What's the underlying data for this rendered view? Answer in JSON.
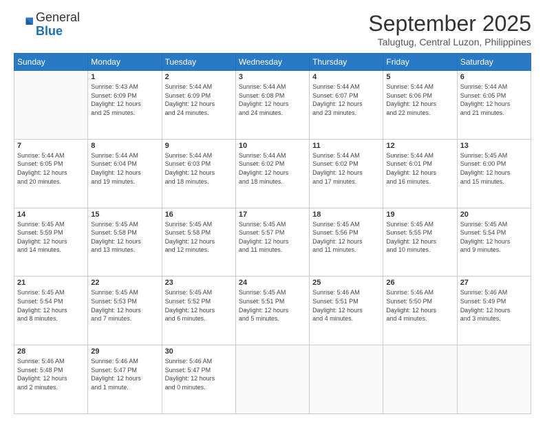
{
  "header": {
    "logo_line1": "General",
    "logo_line2": "Blue",
    "month_title": "September 2025",
    "subtitle": "Talugtug, Central Luzon, Philippines"
  },
  "days_of_week": [
    "Sunday",
    "Monday",
    "Tuesday",
    "Wednesday",
    "Thursday",
    "Friday",
    "Saturday"
  ],
  "weeks": [
    [
      {
        "num": "",
        "sunrise": "",
        "sunset": "",
        "daylight": "",
        "empty": true
      },
      {
        "num": "1",
        "sunrise": "Sunrise: 5:43 AM",
        "sunset": "Sunset: 6:09 PM",
        "daylight": "Daylight: 12 hours and 25 minutes."
      },
      {
        "num": "2",
        "sunrise": "Sunrise: 5:44 AM",
        "sunset": "Sunset: 6:09 PM",
        "daylight": "Daylight: 12 hours and 24 minutes."
      },
      {
        "num": "3",
        "sunrise": "Sunrise: 5:44 AM",
        "sunset": "Sunset: 6:08 PM",
        "daylight": "Daylight: 12 hours and 24 minutes."
      },
      {
        "num": "4",
        "sunrise": "Sunrise: 5:44 AM",
        "sunset": "Sunset: 6:07 PM",
        "daylight": "Daylight: 12 hours and 23 minutes."
      },
      {
        "num": "5",
        "sunrise": "Sunrise: 5:44 AM",
        "sunset": "Sunset: 6:06 PM",
        "daylight": "Daylight: 12 hours and 22 minutes."
      },
      {
        "num": "6",
        "sunrise": "Sunrise: 5:44 AM",
        "sunset": "Sunset: 6:05 PM",
        "daylight": "Daylight: 12 hours and 21 minutes."
      }
    ],
    [
      {
        "num": "7",
        "sunrise": "Sunrise: 5:44 AM",
        "sunset": "Sunset: 6:05 PM",
        "daylight": "Daylight: 12 hours and 20 minutes."
      },
      {
        "num": "8",
        "sunrise": "Sunrise: 5:44 AM",
        "sunset": "Sunset: 6:04 PM",
        "daylight": "Daylight: 12 hours and 19 minutes."
      },
      {
        "num": "9",
        "sunrise": "Sunrise: 5:44 AM",
        "sunset": "Sunset: 6:03 PM",
        "daylight": "Daylight: 12 hours and 18 minutes."
      },
      {
        "num": "10",
        "sunrise": "Sunrise: 5:44 AM",
        "sunset": "Sunset: 6:02 PM",
        "daylight": "Daylight: 12 hours and 18 minutes."
      },
      {
        "num": "11",
        "sunrise": "Sunrise: 5:44 AM",
        "sunset": "Sunset: 6:02 PM",
        "daylight": "Daylight: 12 hours and 17 minutes."
      },
      {
        "num": "12",
        "sunrise": "Sunrise: 5:44 AM",
        "sunset": "Sunset: 6:01 PM",
        "daylight": "Daylight: 12 hours and 16 minutes."
      },
      {
        "num": "13",
        "sunrise": "Sunrise: 5:45 AM",
        "sunset": "Sunset: 6:00 PM",
        "daylight": "Daylight: 12 hours and 15 minutes."
      }
    ],
    [
      {
        "num": "14",
        "sunrise": "Sunrise: 5:45 AM",
        "sunset": "Sunset: 5:59 PM",
        "daylight": "Daylight: 12 hours and 14 minutes."
      },
      {
        "num": "15",
        "sunrise": "Sunrise: 5:45 AM",
        "sunset": "Sunset: 5:58 PM",
        "daylight": "Daylight: 12 hours and 13 minutes."
      },
      {
        "num": "16",
        "sunrise": "Sunrise: 5:45 AM",
        "sunset": "Sunset: 5:58 PM",
        "daylight": "Daylight: 12 hours and 12 minutes."
      },
      {
        "num": "17",
        "sunrise": "Sunrise: 5:45 AM",
        "sunset": "Sunset: 5:57 PM",
        "daylight": "Daylight: 12 hours and 11 minutes."
      },
      {
        "num": "18",
        "sunrise": "Sunrise: 5:45 AM",
        "sunset": "Sunset: 5:56 PM",
        "daylight": "Daylight: 12 hours and 11 minutes."
      },
      {
        "num": "19",
        "sunrise": "Sunrise: 5:45 AM",
        "sunset": "Sunset: 5:55 PM",
        "daylight": "Daylight: 12 hours and 10 minutes."
      },
      {
        "num": "20",
        "sunrise": "Sunrise: 5:45 AM",
        "sunset": "Sunset: 5:54 PM",
        "daylight": "Daylight: 12 hours and 9 minutes."
      }
    ],
    [
      {
        "num": "21",
        "sunrise": "Sunrise: 5:45 AM",
        "sunset": "Sunset: 5:54 PM",
        "daylight": "Daylight: 12 hours and 8 minutes."
      },
      {
        "num": "22",
        "sunrise": "Sunrise: 5:45 AM",
        "sunset": "Sunset: 5:53 PM",
        "daylight": "Daylight: 12 hours and 7 minutes."
      },
      {
        "num": "23",
        "sunrise": "Sunrise: 5:45 AM",
        "sunset": "Sunset: 5:52 PM",
        "daylight": "Daylight: 12 hours and 6 minutes."
      },
      {
        "num": "24",
        "sunrise": "Sunrise: 5:45 AM",
        "sunset": "Sunset: 5:51 PM",
        "daylight": "Daylight: 12 hours and 5 minutes."
      },
      {
        "num": "25",
        "sunrise": "Sunrise: 5:46 AM",
        "sunset": "Sunset: 5:51 PM",
        "daylight": "Daylight: 12 hours and 4 minutes."
      },
      {
        "num": "26",
        "sunrise": "Sunrise: 5:46 AM",
        "sunset": "Sunset: 5:50 PM",
        "daylight": "Daylight: 12 hours and 4 minutes."
      },
      {
        "num": "27",
        "sunrise": "Sunrise: 5:46 AM",
        "sunset": "Sunset: 5:49 PM",
        "daylight": "Daylight: 12 hours and 3 minutes."
      }
    ],
    [
      {
        "num": "28",
        "sunrise": "Sunrise: 5:46 AM",
        "sunset": "Sunset: 5:48 PM",
        "daylight": "Daylight: 12 hours and 2 minutes."
      },
      {
        "num": "29",
        "sunrise": "Sunrise: 5:46 AM",
        "sunset": "Sunset: 5:47 PM",
        "daylight": "Daylight: 12 hours and 1 minute."
      },
      {
        "num": "30",
        "sunrise": "Sunrise: 5:46 AM",
        "sunset": "Sunset: 5:47 PM",
        "daylight": "Daylight: 12 hours and 0 minutes."
      },
      {
        "num": "",
        "sunrise": "",
        "sunset": "",
        "daylight": "",
        "empty": true
      },
      {
        "num": "",
        "sunrise": "",
        "sunset": "",
        "daylight": "",
        "empty": true
      },
      {
        "num": "",
        "sunrise": "",
        "sunset": "",
        "daylight": "",
        "empty": true
      },
      {
        "num": "",
        "sunrise": "",
        "sunset": "",
        "daylight": "",
        "empty": true
      }
    ]
  ]
}
